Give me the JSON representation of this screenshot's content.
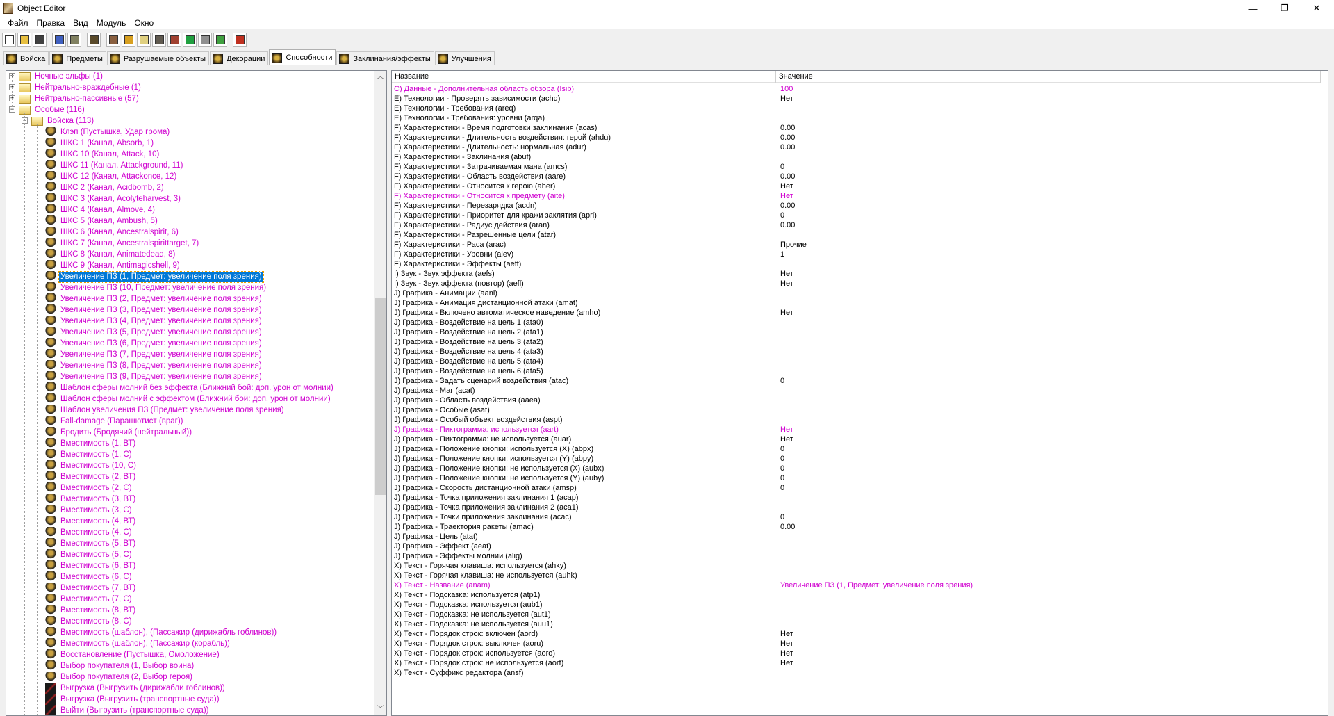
{
  "window": {
    "title": "Object Editor",
    "minimize": "—",
    "maximize": "❐",
    "close": "✕"
  },
  "menu": [
    "Файл",
    "Правка",
    "Вид",
    "Модуль",
    "Окно"
  ],
  "toolbar": [
    {
      "name": "new-file-icon",
      "color": "#ffffff"
    },
    {
      "name": "open-folder-icon",
      "color": "#e8c040"
    },
    {
      "name": "save-icon",
      "color": "#404040"
    },
    null,
    {
      "name": "copy-icon",
      "color": "#4060c0"
    },
    {
      "name": "paste-icon",
      "color": "#808060"
    },
    null,
    {
      "name": "abilities-icon",
      "color": "#5a4a2a"
    },
    null,
    {
      "name": "terrain-icon",
      "color": "#8a6040"
    },
    {
      "name": "text-icon",
      "color": "#d8a020"
    },
    {
      "name": "sound-icon",
      "color": "#e0d080"
    },
    {
      "name": "units-icon",
      "color": "#605a50"
    },
    {
      "name": "ui-icon",
      "color": "#a04030"
    },
    {
      "name": "doodad-icon",
      "color": "#20a040"
    },
    {
      "name": "model-icon",
      "color": "#909090"
    },
    {
      "name": "import-icon",
      "color": "#40a040"
    },
    null,
    {
      "name": "checklist-icon",
      "color": "#c03020"
    }
  ],
  "tabs": [
    {
      "label": "Войска",
      "active": false
    },
    {
      "label": "Предметы",
      "active": false
    },
    {
      "label": "Разрушаемые объекты",
      "active": false
    },
    {
      "label": "Декорации",
      "active": false
    },
    {
      "label": "Способности",
      "active": true
    },
    {
      "label": "Заклинания/эффекты",
      "active": false
    },
    {
      "label": "Улучшения",
      "active": false
    }
  ],
  "tree": {
    "folders": [
      {
        "label": "Ночные эльфы (1)",
        "expanded": false,
        "level": 0
      },
      {
        "label": "Нейтрально-враждебные (1)",
        "expanded": false,
        "level": 0
      },
      {
        "label": "Нейтрально-пассивные (57)",
        "expanded": false,
        "level": 0
      },
      {
        "label": "Особые (116)",
        "expanded": true,
        "level": 0
      },
      {
        "label": "Войска (113)",
        "expanded": true,
        "level": 1
      }
    ],
    "selected_index": 13,
    "items": [
      "Клэп (Пустышка, Удар грома)",
      "ШКС 1 (Канал, Absorb, 1)",
      "ШКС 10 (Канал, Attack, 10)",
      "ШКС 11 (Канал, Attackground, 11)",
      "ШКС 12 (Канал, Attackonce, 12)",
      "ШКС 2 (Канал, Acidbomb, 2)",
      "ШКС 3 (Канал, Acolyteharvest, 3)",
      "ШКС 4 (Канал, Almove, 4)",
      "ШКС 5 (Канал, Ambush, 5)",
      "ШКС 6 (Канал, Ancestralspirit, 6)",
      "ШКС 7 (Канал, Ancestralspirittarget, 7)",
      "ШКС 8 (Канал, Animatedead, 8)",
      "ШКС 9 (Канал, Antimagicshell, 9)",
      "Увеличение ПЗ (1, Предмет: увеличение поля зрения)",
      "Увеличение ПЗ (10, Предмет: увеличение поля зрения)",
      "Увеличение ПЗ (2, Предмет: увеличение поля зрения)",
      "Увеличение ПЗ (3, Предмет: увеличение поля зрения)",
      "Увеличение ПЗ (4, Предмет: увеличение поля зрения)",
      "Увеличение ПЗ (5, Предмет: увеличение поля зрения)",
      "Увеличение ПЗ (6, Предмет: увеличение поля зрения)",
      "Увеличение ПЗ (7, Предмет: увеличение поля зрения)",
      "Увеличение ПЗ (8, Предмет: увеличение поля зрения)",
      "Увеличение ПЗ (9, Предмет: увеличение поля зрения)",
      "Шаблон сферы молний без эффекта (Ближний бой: доп. урон от молнии)",
      "Шаблон сферы молний с эффектом (Ближний бой: доп. урон от молнии)",
      "Шаблон увеличения ПЗ (Предмет: увеличение поля зрения)",
      "Fall-damage (Парашютист (враг))",
      "Бродить (Бродячий (нейтральный))",
      "Вместимость (1, ВТ)",
      "Вместимость (1, С)",
      "Вместимость (10, С)",
      "Вместимость (2, ВТ)",
      "Вместимость (2, С)",
      "Вместимость (3, ВТ)",
      "Вместимость (3, С)",
      "Вместимость (4, ВТ)",
      "Вместимость (4, С)",
      "Вместимость (5, ВТ)",
      "Вместимость (5, С)",
      "Вместимость (6, ВТ)",
      "Вместимость (6, С)",
      "Вместимость (7, ВТ)",
      "Вместимость (7, С)",
      "Вместимость (8, ВТ)",
      "Вместимость (8, С)",
      "Вместимость (шаблон), (Пассажир (дирижабль гоблинов))",
      "Вместимость (шаблон), (Пассажир (корабль))",
      "Восстановление (Пустышка, Омоложение)",
      "Выбор покупателя (1, Выбор воина)",
      "Выбор покупателя (2, Выбор героя)",
      "Выгрузка (Выгрузить (дирижабли гоблинов))",
      "Выгрузка (Выгрузить (транспортные суда))",
      "Выйти (Выгрузить (транспортные суда))"
    ],
    "unload_icon_from": 50,
    "scroll_fraction": 0.35
  },
  "props": {
    "headers": [
      "Название",
      "Значение"
    ],
    "rows": [
      {
        "n": "C) Данные - Дополнительная область обзора (Isib)",
        "v": "100",
        "m": true
      },
      {
        "n": "E) Технологии - Проверять зависимости (achd)",
        "v": "Нет"
      },
      {
        "n": "E) Технологии - Требования (areq)",
        "v": ""
      },
      {
        "n": "E) Технологии - Требования: уровни (arqa)",
        "v": ""
      },
      {
        "n": "F) Характеристики - Время подготовки заклинания (acas)",
        "v": "0.00"
      },
      {
        "n": "F) Характеристики - Длительность воздействия: герой (ahdu)",
        "v": "0.00"
      },
      {
        "n": "F) Характеристики - Длительность: нормальная (adur)",
        "v": "0.00"
      },
      {
        "n": "F) Характеристики - Заклинания (abuf)",
        "v": ""
      },
      {
        "n": "F) Характеристики - Затрачиваемая мана (amcs)",
        "v": "0"
      },
      {
        "n": "F) Характеристики - Область воздействия (aare)",
        "v": "0.00"
      },
      {
        "n": "F) Характеристики - Относится к герою (aher)",
        "v": "Нет"
      },
      {
        "n": "F) Характеристики - Относится к предмету (aite)",
        "v": "Нет",
        "m": true
      },
      {
        "n": "F) Характеристики - Перезарядка (acdn)",
        "v": "0.00"
      },
      {
        "n": "F) Характеристики - Приоритет для кражи заклятия (apri)",
        "v": "0"
      },
      {
        "n": "F) Характеристики - Радиус действия (aran)",
        "v": "0.00"
      },
      {
        "n": "F) Характеристики - Разрешенные цели (atar)",
        "v": ""
      },
      {
        "n": "F) Характеристики - Раса (arac)",
        "v": "Прочие"
      },
      {
        "n": "F) Характеристики - Уровни (alev)",
        "v": "1"
      },
      {
        "n": "F) Характеристики - Эффекты (aeff)",
        "v": ""
      },
      {
        "n": "I) Звук - Звук эффекта (aefs)",
        "v": "Нет"
      },
      {
        "n": "I) Звук - Звук эффекта (повтор) (aefl)",
        "v": "Нет"
      },
      {
        "n": "J) Графика - Анимации (aani)",
        "v": ""
      },
      {
        "n": "J) Графика - Анимация дистанционной атаки (amat)",
        "v": ""
      },
      {
        "n": "J) Графика - Включено автоматическое наведение (amho)",
        "v": "Нет"
      },
      {
        "n": "J) Графика - Воздействие на цель 1 (ata0)",
        "v": ""
      },
      {
        "n": "J) Графика - Воздействие на цель 2 (ata1)",
        "v": ""
      },
      {
        "n": "J) Графика - Воздействие на цель 3 (ata2)",
        "v": ""
      },
      {
        "n": "J) Графика - Воздействие на цель 4 (ata3)",
        "v": ""
      },
      {
        "n": "J) Графика - Воздействие на цель 5 (ata4)",
        "v": ""
      },
      {
        "n": "J) Графика - Воздействие на цель 6 (ata5)",
        "v": ""
      },
      {
        "n": "J) Графика - Задать сценарий воздействия (atac)",
        "v": "0"
      },
      {
        "n": "J) Графика - Маг (acat)",
        "v": ""
      },
      {
        "n": "J) Графика - Область воздействия (aaea)",
        "v": ""
      },
      {
        "n": "J) Графика - Особые (asat)",
        "v": ""
      },
      {
        "n": "J) Графика - Особый объект воздействия (aspt)",
        "v": ""
      },
      {
        "n": "J) Графика - Пиктограмма: используется (aart)",
        "v": "Нет",
        "m": true
      },
      {
        "n": "J) Графика - Пиктограмма: не используется (auar)",
        "v": "Нет"
      },
      {
        "n": "J) Графика - Положение кнопки: используется (X) (abpx)",
        "v": "0"
      },
      {
        "n": "J) Графика - Положение кнопки: используется (Y) (abpy)",
        "v": "0"
      },
      {
        "n": "J) Графика - Положение кнопки: не используется (X) (aubx)",
        "v": "0"
      },
      {
        "n": "J) Графика - Положение кнопки: не используется (Y) (auby)",
        "v": "0"
      },
      {
        "n": "J) Графика - Скорость дистанционной атаки (amsp)",
        "v": "0"
      },
      {
        "n": "J) Графика - Точка приложения заклинания 1 (acap)",
        "v": ""
      },
      {
        "n": "J) Графика - Точка приложения заклинания 2 (aca1)",
        "v": ""
      },
      {
        "n": "J) Графика - Точки приложения заклинания (acac)",
        "v": "0"
      },
      {
        "n": "J) Графика - Траектория ракеты (amac)",
        "v": "0.00"
      },
      {
        "n": "J) Графика - Цель (atat)",
        "v": ""
      },
      {
        "n": "J) Графика - Эффект (aeat)",
        "v": ""
      },
      {
        "n": "J) Графика - Эффекты молнии (alig)",
        "v": ""
      },
      {
        "n": "X) Текст - Горячая клавиша: используется (ahky)",
        "v": ""
      },
      {
        "n": "X) Текст - Горячая клавиша: не используется (auhk)",
        "v": ""
      },
      {
        "n": "X) Текст - Название (anam)",
        "v": "Увеличение ПЗ (1, Предмет: увеличение поля зрения)",
        "m": true
      },
      {
        "n": "X) Текст - Подсказка: используется (atp1)",
        "v": ""
      },
      {
        "n": "X) Текст - Подсказка: используется (aub1)",
        "v": ""
      },
      {
        "n": "X) Текст - Подсказка: не используется (aut1)",
        "v": ""
      },
      {
        "n": "X) Текст - Подсказка: не используется (auu1)",
        "v": ""
      },
      {
        "n": "X) Текст - Порядок строк: включен (aord)",
        "v": "Нет"
      },
      {
        "n": "X) Текст - Порядок строк: выключен (aoru)",
        "v": "Нет"
      },
      {
        "n": "X) Текст - Порядок строк: используется (aoro)",
        "v": "Нет"
      },
      {
        "n": "X) Текст - Порядок строк: не используется (aorf)",
        "v": "Нет"
      },
      {
        "n": "X) Текст - Суффикс редактора (ansf)",
        "v": ""
      }
    ]
  },
  "colors": {
    "modified": "#d000d0",
    "selection": "#0078d7"
  }
}
